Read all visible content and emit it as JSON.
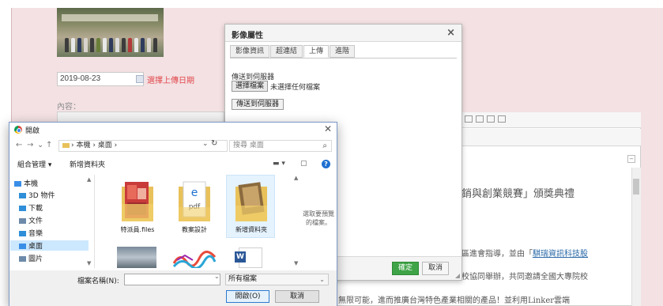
{
  "cms": {
    "date_value": "2019-08-23",
    "date_link": "選擇上傳日期",
    "content_label": "內容：",
    "editor_heading": "銷與創業競賽」頒獎典禮",
    "editor_p1_prefix": "區進會指導，並由「",
    "editor_p1_link": "騏瑞資訊科技股",
    "editor_p2": "校協同舉辦，共同邀請全國大專院校",
    "editor_p3": "無限可能，進而推廣台灣特色產業相關的產品！並利用Linker雲端"
  },
  "image_dialog": {
    "title": "影像屬性",
    "close": "×",
    "tabs": [
      {
        "label": "影像資訊",
        "active": false
      },
      {
        "label": "超連結",
        "active": false
      },
      {
        "label": "上傳",
        "active": true
      },
      {
        "label": "進階",
        "active": false
      }
    ],
    "upload_label": "傳送到伺服器",
    "choose_file_button": "選擇檔案",
    "no_file_text": "未選擇任何檔案",
    "send_button": "傳送到伺服器",
    "ok_button": "確定",
    "cancel_button": "取消"
  },
  "open_dialog": {
    "title": "開啟",
    "close": "✕",
    "nav": {
      "back": "←",
      "forward": "→",
      "recent": "⌄",
      "up": "↑"
    },
    "address_path": "› 本機 › 桌面 ›",
    "refresh": "↻",
    "search_placeholder": "搜尋 桌面",
    "search_icon": "⌕",
    "organize": "組合管理 ▾",
    "new_folder": "新增資料夾",
    "help": "?",
    "tree": [
      {
        "label": "本機",
        "icon_color": "#3a8ee6",
        "selected": false
      },
      {
        "label": "3D 物件",
        "icon_color": "#2f8fd8",
        "selected": false
      },
      {
        "label": "下載",
        "icon_color": "#2f8fd8",
        "selected": false
      },
      {
        "label": "文件",
        "icon_color": "#6d8aa9",
        "selected": false
      },
      {
        "label": "音樂",
        "icon_color": "#2f8fd8",
        "selected": false
      },
      {
        "label": "桌面",
        "icon_color": "#3a8ee6",
        "selected": true
      },
      {
        "label": "圖片",
        "icon_color": "#6d8aa9",
        "selected": false
      }
    ],
    "files": [
      {
        "label": "特派員.files",
        "kind": "folder-red"
      },
      {
        "label": "教案設計",
        "kind": "folder-pdf"
      },
      {
        "label": "新增資料夾",
        "kind": "folder-photo",
        "selected": true
      }
    ],
    "preview_text": "選取要預覽的檔案。",
    "filename_label": "檔案名稱(N):",
    "filename_value": "",
    "filetype": "所有檔案",
    "open_button": "開啟(O)",
    "cancel_button": "取消"
  },
  "colors": {
    "accent_red": "#e2474b",
    "ok_green": "#3fa447",
    "selection_blue": "#cce8ff"
  }
}
